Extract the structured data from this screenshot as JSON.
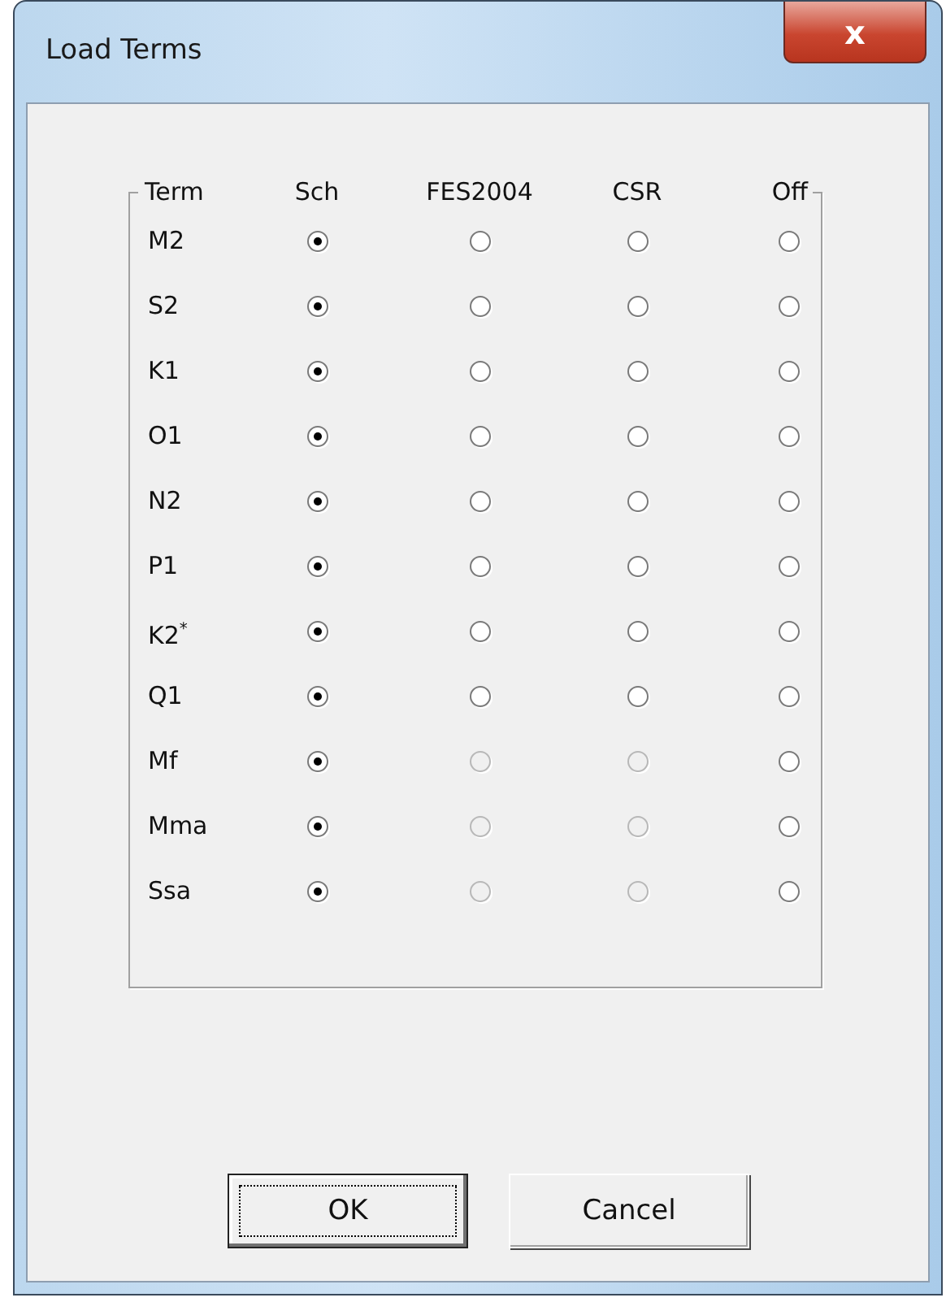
{
  "window": {
    "title": "Load Terms",
    "close": "x"
  },
  "columns": [
    "Term",
    "Sch",
    "FES2004",
    "CSR",
    "Off"
  ],
  "rows": [
    {
      "term": "M2",
      "options": [
        {
          "selected": true,
          "disabled": false
        },
        {
          "selected": false,
          "disabled": false
        },
        {
          "selected": false,
          "disabled": false
        },
        {
          "selected": false,
          "disabled": false
        }
      ]
    },
    {
      "term": "S2",
      "options": [
        {
          "selected": true,
          "disabled": false
        },
        {
          "selected": false,
          "disabled": false
        },
        {
          "selected": false,
          "disabled": false
        },
        {
          "selected": false,
          "disabled": false
        }
      ]
    },
    {
      "term": "K1",
      "options": [
        {
          "selected": true,
          "disabled": false
        },
        {
          "selected": false,
          "disabled": false
        },
        {
          "selected": false,
          "disabled": false
        },
        {
          "selected": false,
          "disabled": false
        }
      ]
    },
    {
      "term": "O1",
      "options": [
        {
          "selected": true,
          "disabled": false
        },
        {
          "selected": false,
          "disabled": false
        },
        {
          "selected": false,
          "disabled": false
        },
        {
          "selected": false,
          "disabled": false
        }
      ]
    },
    {
      "term": "N2",
      "options": [
        {
          "selected": true,
          "disabled": false
        },
        {
          "selected": false,
          "disabled": false
        },
        {
          "selected": false,
          "disabled": false
        },
        {
          "selected": false,
          "disabled": false
        }
      ]
    },
    {
      "term": "P1",
      "options": [
        {
          "selected": true,
          "disabled": false
        },
        {
          "selected": false,
          "disabled": false
        },
        {
          "selected": false,
          "disabled": false
        },
        {
          "selected": false,
          "disabled": false
        }
      ]
    },
    {
      "term": "K2$^{*}$",
      "options": [
        {
          "selected": true,
          "disabled": false
        },
        {
          "selected": false,
          "disabled": false
        },
        {
          "selected": false,
          "disabled": false
        },
        {
          "selected": false,
          "disabled": false
        }
      ]
    },
    {
      "term": "Q1",
      "options": [
        {
          "selected": true,
          "disabled": false
        },
        {
          "selected": false,
          "disabled": false
        },
        {
          "selected": false,
          "disabled": false
        },
        {
          "selected": false,
          "disabled": false
        }
      ]
    },
    {
      "term": "Mf",
      "options": [
        {
          "selected": true,
          "disabled": false
        },
        {
          "selected": false,
          "disabled": true
        },
        {
          "selected": false,
          "disabled": true
        },
        {
          "selected": false,
          "disabled": false
        }
      ]
    },
    {
      "term": "Mma",
      "options": [
        {
          "selected": true,
          "disabled": false
        },
        {
          "selected": false,
          "disabled": true
        },
        {
          "selected": false,
          "disabled": true
        },
        {
          "selected": false,
          "disabled": false
        }
      ]
    },
    {
      "term": "Ssa",
      "options": [
        {
          "selected": true,
          "disabled": false
        },
        {
          "selected": false,
          "disabled": true
        },
        {
          "selected": false,
          "disabled": true
        },
        {
          "selected": false,
          "disabled": false
        }
      ]
    }
  ],
  "buttons": [
    {
      "label": "OK",
      "focused": true
    },
    {
      "label": "Cancel",
      "focused": false
    }
  ]
}
